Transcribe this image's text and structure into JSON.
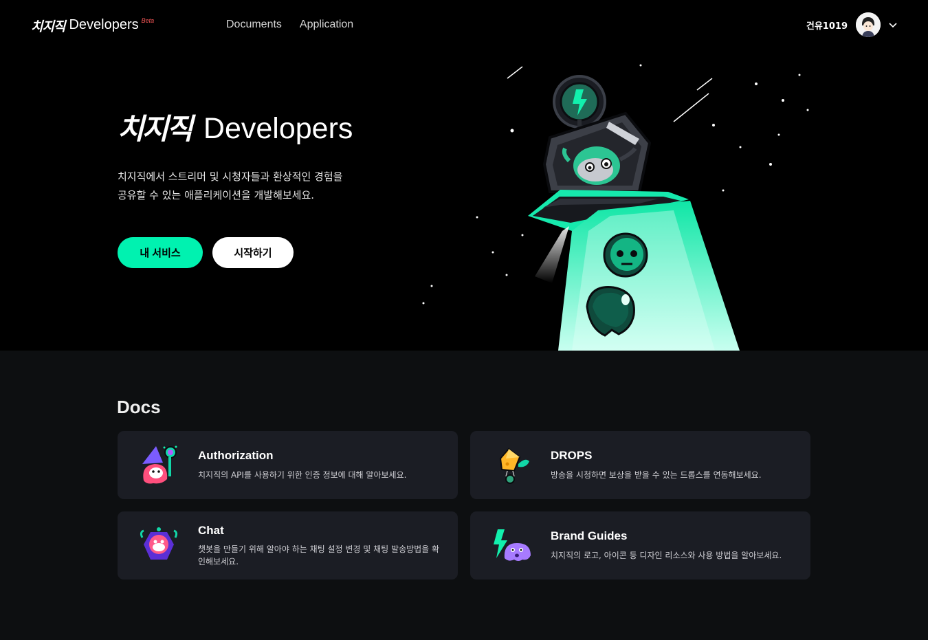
{
  "header": {
    "logo_text": "치지직",
    "brand_name": "Developers",
    "beta_label": "Beta",
    "nav": [
      {
        "label": "Documents"
      },
      {
        "label": "Application"
      }
    ],
    "username": "건유1019"
  },
  "hero": {
    "logo_text": "치지직",
    "title": "Developers",
    "description_lines": [
      "치지직에서 스트리머 및 시청자들과 환상적인 경험을",
      "공유할 수 있는 애플리케이션을 개발해보세요."
    ],
    "primary_button": "내 서비스",
    "secondary_button": "시작하기",
    "accent_color": "#00f2b0"
  },
  "docs": {
    "title": "Docs",
    "cards": [
      {
        "title": "Authorization",
        "description": "치지직의 API를 사용하기 위한 인증 정보에 대해 알아보세요.",
        "icon": "wizard-mascot-icon"
      },
      {
        "title": "DROPS",
        "description": "방송을 시청하면 보상을 받을 수 있는 드롭스를 연동해보세요.",
        "icon": "cheese-mascot-icon"
      },
      {
        "title": "Chat",
        "description": "챗봇을 만들기 위해 알아야 하는 채팅 설정 변경 및 채팅 발송방법을 확인해보세요.",
        "icon": "chat-mascot-icon"
      },
      {
        "title": "Brand Guides",
        "description": "치지직의 로고, 아이콘 등 디자인 리소스와 사용 방법을 알아보세요.",
        "icon": "brand-mascot-icon"
      }
    ]
  }
}
